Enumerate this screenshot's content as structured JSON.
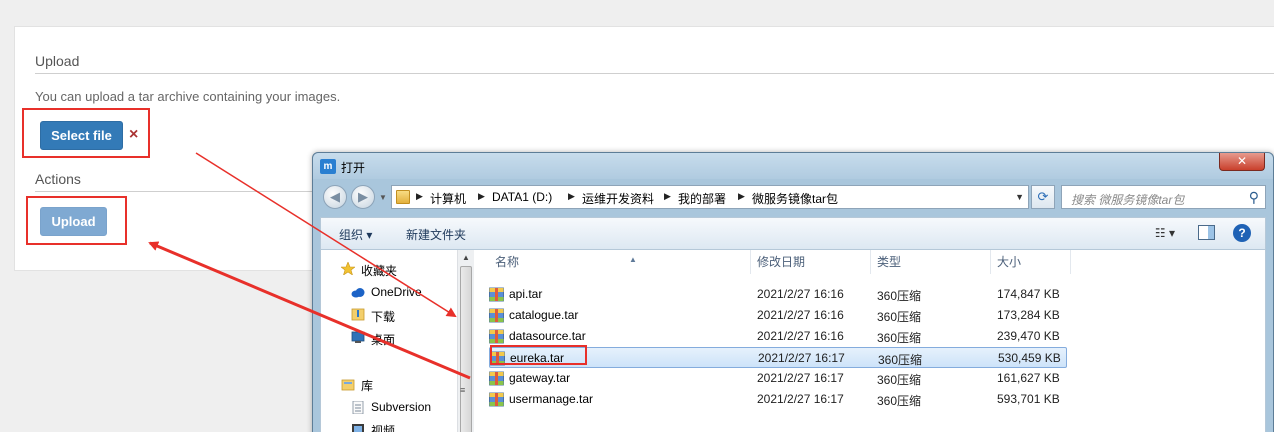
{
  "page": {
    "upload_title": "Upload",
    "help_text": "You can upload a tar archive containing your images.",
    "select_file_label": "Select file",
    "remove_label": "×",
    "actions_title": "Actions",
    "upload_label": "Upload"
  },
  "dialog": {
    "title": "打开",
    "close_label": "✕",
    "breadcrumbs": [
      "计算机",
      "DATA1 (D:)",
      "运维开发资料",
      "我的部署",
      "微服务镜像tar包"
    ],
    "search_placeholder": "搜索 微服务镜像tar包",
    "toolbar": {
      "organize": "组织 ▾",
      "new_folder": "新建文件夹",
      "view": "☷ ▾"
    },
    "nav_items": [
      {
        "label": "收藏夹",
        "icon": "star-icon"
      },
      {
        "label": "OneDrive",
        "icon": "cloud-icon"
      },
      {
        "label": "下载",
        "icon": "folder-icon"
      },
      {
        "label": "桌面",
        "icon": "desktop-icon"
      },
      {
        "label": "库",
        "icon": "library-icon"
      },
      {
        "label": "Subversion",
        "icon": "document-icon"
      },
      {
        "label": "视频",
        "icon": "video-icon"
      }
    ],
    "columns": {
      "name": "名称",
      "date": "修改日期",
      "type": "类型",
      "size": "大小"
    },
    "files": [
      {
        "name": "api.tar",
        "date": "2021/2/27 16:16",
        "type": "360压缩",
        "size": "174,847 KB"
      },
      {
        "name": "catalogue.tar",
        "date": "2021/2/27 16:16",
        "type": "360压缩",
        "size": "173,284 KB"
      },
      {
        "name": "datasource.tar",
        "date": "2021/2/27 16:16",
        "type": "360压缩",
        "size": "239,470 KB"
      },
      {
        "name": "eureka.tar",
        "date": "2021/2/27 16:17",
        "type": "360压缩",
        "size": "530,459 KB"
      },
      {
        "name": "gateway.tar",
        "date": "2021/2/27 16:17",
        "type": "360压缩",
        "size": "161,627 KB"
      },
      {
        "name": "usermanage.tar",
        "date": "2021/2/27 16:17",
        "type": "360压缩",
        "size": "593,701 KB"
      }
    ],
    "selected_file": "eureka.tar"
  },
  "colors": {
    "primary": "#337ab7",
    "annotation_red": "#e8302a",
    "selection": "#cde3f9"
  }
}
